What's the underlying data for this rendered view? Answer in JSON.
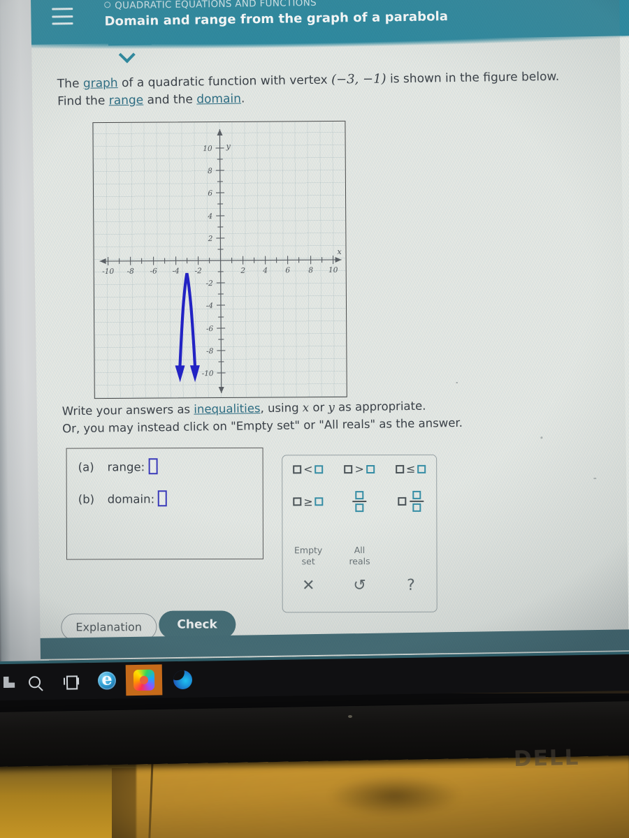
{
  "header": {
    "breadcrumb": "QUADRATIC EQUATIONS AND FUNCTIONS",
    "title": "Domain and range from the graph of a parabola",
    "menu_icon": "hamburger-icon",
    "crumb_icon": "circle-icon",
    "expand_icon": "chevron-down-icon",
    "accent_color": "#2f8ba1"
  },
  "statement": {
    "line1_a": "The ",
    "link_graph": "graph",
    "line1_b": " of a quadratic function with vertex ",
    "vertex": "(−3, −1)",
    "line1_c": " is shown in the figure below.",
    "line2_a": "Find the ",
    "link_range": "range",
    "line2_b": " and the ",
    "link_domain": "domain",
    "line2_c": "."
  },
  "instructions": {
    "line1_a": "Write your answers as ",
    "link_inequalities": "inequalities",
    "line1_b": ", using ",
    "var_x": "x",
    "line1_c": " or ",
    "var_y": "y",
    "line1_d": " as appropriate.",
    "line2": "Or, you may instead click on \"Empty set\" or \"All reals\" as the answer."
  },
  "answers": {
    "a_tag": "(a)",
    "a_label": "range:",
    "a_value": "",
    "b_tag": "(b)",
    "b_label": "domain:",
    "b_value": ""
  },
  "keypad": {
    "buttons": [
      {
        "name": "less-than",
        "left": "□",
        "op": "<",
        "right": "□"
      },
      {
        "name": "greater-than",
        "left": "□",
        "op": ">",
        "right": "□"
      },
      {
        "name": "less-equal",
        "left": "□",
        "op": "≤",
        "right": "□"
      },
      {
        "name": "greater-equal",
        "left": "□",
        "op": "≥",
        "right": "□"
      }
    ],
    "fraction_label": "fraction",
    "mixed_label": "mixed-number",
    "empty_set": "Empty\nset",
    "empty_set_l1": "Empty",
    "empty_set_l2": "set",
    "all_reals_l1": "All",
    "all_reals_l2": "reals",
    "clear_icon": "✕",
    "undo_icon": "↺",
    "help_icon": "?"
  },
  "actions": {
    "explanation": "Explanation",
    "check": "Check",
    "check_color": "#3e6a74"
  },
  "taskbar": {
    "items": [
      {
        "name": "start-button",
        "icon": "windows-icon"
      },
      {
        "name": "search-button",
        "icon": "search-icon"
      },
      {
        "name": "task-view-button",
        "icon": "task-view-icon"
      },
      {
        "name": "internet-explorer-button",
        "icon": "internet-explorer-icon"
      },
      {
        "name": "creative-cloud-button",
        "icon": "creative-cloud-icon"
      },
      {
        "name": "microsoft-edge-button",
        "icon": "edge-icon"
      }
    ]
  },
  "monitor": {
    "brand": "DELL"
  },
  "chart_data": {
    "type": "line",
    "title": "",
    "xlabel": "x",
    "ylabel": "y",
    "xlim": [
      -11,
      11
    ],
    "ylim": [
      -11,
      11
    ],
    "grid": true,
    "xticks": [
      -10,
      -8,
      -6,
      -4,
      -2,
      2,
      4,
      6,
      8,
      10
    ],
    "yticks": [
      10,
      8,
      6,
      4,
      2,
      -2,
      -4,
      -6,
      -8,
      -10
    ],
    "xtick_labels": [
      "-10",
      "-8",
      "-6",
      "-4",
      "-2",
      "2",
      "4",
      "6",
      "8",
      "10"
    ],
    "ytick_labels": [
      "10",
      "8",
      "6",
      "4",
      "2",
      "-2",
      "-4",
      "-6",
      "-8",
      "-10"
    ],
    "curve_color": "#2323c8",
    "series": [
      {
        "name": "parabola",
        "equation": "y = -9(x + 3)^2 - 1",
        "vertex": [
          -3,
          -1
        ],
        "opens": "down",
        "arrow_ends": [
          [
            -4,
            -10
          ],
          [
            -2,
            -10
          ]
        ],
        "x": [
          -4.0,
          -3.8,
          -3.6,
          -3.4,
          -3.2,
          -3.0,
          -2.8,
          -2.6,
          -2.4,
          -2.2,
          -2.0
        ],
        "y": [
          -10.0,
          -6.76,
          -4.24,
          -2.44,
          -1.36,
          -1.0,
          -1.36,
          -2.44,
          -4.24,
          -6.76,
          -10.0
        ]
      }
    ]
  }
}
